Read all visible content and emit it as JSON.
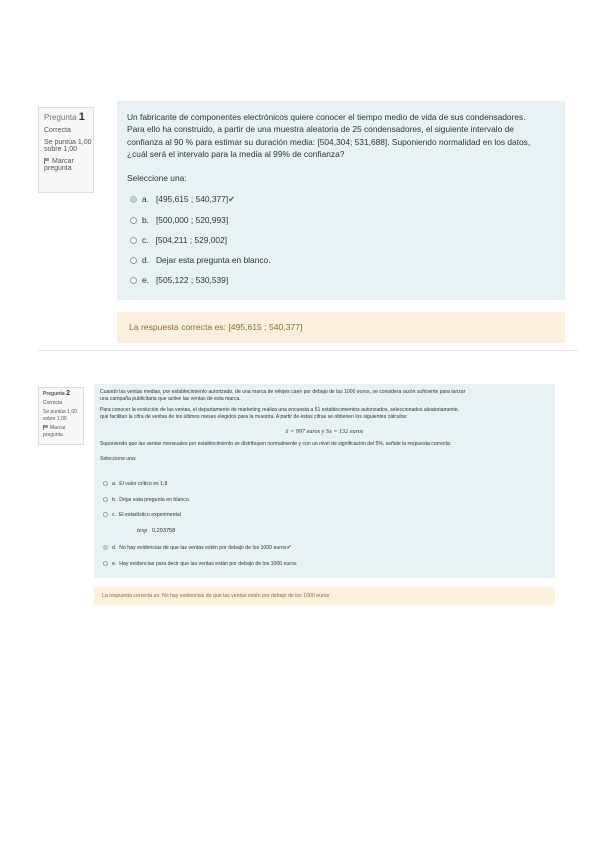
{
  "q1": {
    "info": {
      "label": "Pregunta",
      "number": "1",
      "state": "Correcta",
      "score_line1": "Se puntúa 1,00",
      "score_line2": "sobre 1,00",
      "flag_line1": "Marcar",
      "flag_line2": "pregunta",
      "flag_icon": "flag-icon"
    },
    "text": [
      "Un fabricante de componentes electrónicos quiere conocer el tiempo medio de vida de sus condensadores.",
      "Para ello ha construido, a partir de una muestra aleatoria de 25 condensadores, el siguiente intervalo de",
      "confianza al 90 % para estimar su duración media: [504,304; 531,688]. Suponiendo normalidad en los datos,",
      "¿cuál será el intervalo para la media al 99% de confianza?"
    ],
    "select_label": "Seleccione una:",
    "options": [
      {
        "letter": "a.",
        "text": "[495,615 ; 540,377]",
        "checked": true,
        "correct": true
      },
      {
        "letter": "b.",
        "text": "[500,000 ; 520,993]",
        "checked": false,
        "correct": false
      },
      {
        "letter": "c.",
        "text": "[504,211 ; 529,002]",
        "checked": false,
        "correct": false
      },
      {
        "letter": "d.",
        "text": "Dejar esta pregunta en blanco.",
        "checked": false,
        "correct": false
      },
      {
        "letter": "e.",
        "text": "[505,122 ; 530,539]",
        "checked": false,
        "correct": false
      }
    ],
    "feedback": "La respuesta correcta es: [495,615 ; 540,377]",
    "colors": {
      "panel": "#e8f2f5",
      "feedback": "#fcefdc",
      "correct_mark": "#2e7d32"
    }
  },
  "q2": {
    "info": {
      "label": "Pregunta",
      "number": "2",
      "state": "Correcta",
      "score_line1": "Se puntúa 1,00",
      "score_line2": "sobre 1,00",
      "flag_line1": "Marcar",
      "flag_line2": "pregunta",
      "flag_icon": "flag-icon"
    },
    "text": [
      "Cuando las ventas medias, por establecimiento autorizado, de una marca de relojes caen por debajo de las 1000 euros, se considera razón suficiente para lanzar",
      "una campaña publicitaria que active las ventas de esta marca.",
      "Para conocer la evolución de las ventas, el departamento de marketing realiza una encuesta a 51 establecimientos autorizados, seleccionados aleatoriamente,",
      "que facilitan la cifra de ventas de los últimos meses elegidos para la muestra. A partir de estas cifras se obtienen los siguientes cálculos:"
    ],
    "formula": "x̄ = 997 euros  y  Sx = 132 euros",
    "assumption": "Suponiendo que las ventas mensuales por establecimiento se distribuyen normalmente y con un nivel de significación del 5%, señale la respuesta correcta:",
    "select_label": "Seleccione una:",
    "options": [
      {
        "letter": "a.",
        "text": "El valor crítico es 1,8",
        "checked": false,
        "correct": false
      },
      {
        "letter": "b.",
        "text": "Dejar esta pregunta en blanco.",
        "checked": false,
        "correct": false
      },
      {
        "letter": "c.",
        "text": "El estadístico experimental",
        "checked": false,
        "correct": false
      },
      {
        "letter": "d.",
        "text": "No hay evidencias de que las ventas estén por debajo de los 1000 euros",
        "checked": true,
        "correct": true
      },
      {
        "letter": "e.",
        "text": "Hay evidencias para decir que las ventas están por debajo de los 1000 euros",
        "checked": false,
        "correct": false
      }
    ],
    "statistic_label": "texp",
    "statistic_value": "0,293758",
    "feedback": "La respuesta correcta es: No hay evidencias de que las ventas estén por debajo de los 1000 euros",
    "colors": {
      "panel": "#e8f2f5",
      "feedback": "#fcefdc",
      "correct_mark": "#2e7d32"
    }
  }
}
